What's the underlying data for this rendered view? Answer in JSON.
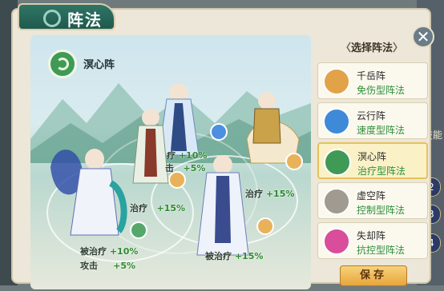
{
  "title": "阵法",
  "close_glyph": "✕",
  "side": {
    "skill_label": "技能",
    "numbers": [
      "2",
      "3",
      "4"
    ]
  },
  "scene": {
    "formation_name": "溟心阵",
    "buffs": [
      {
        "label": "疗",
        "value": "+10%"
      },
      {
        "label": "击",
        "value": "+5%"
      },
      {
        "label": "治疗",
        "value": "+15%"
      },
      {
        "label": "治疗",
        "value": "+15%"
      },
      {
        "label": "被治疗",
        "value": "+10%"
      },
      {
        "label": "攻击",
        "value": "+5%"
      },
      {
        "label": "被治疗",
        "value": "+15%"
      }
    ]
  },
  "panel": {
    "header": "选择阵法",
    "arrow_left": "〈",
    "arrow_right": "〉",
    "formations": [
      {
        "name": "千岳阵",
        "type": "免伤型阵法",
        "color": "#e2a247"
      },
      {
        "name": "云行阵",
        "type": "速度型阵法",
        "color": "#3f8ad8"
      },
      {
        "name": "溟心阵",
        "type": "治疗型阵法",
        "color": "#3f9a55",
        "selected": true
      },
      {
        "name": "虚空阵",
        "type": "控制型阵法",
        "color": "#a09a90"
      },
      {
        "name": "失却阵",
        "type": "抗控型阵法",
        "color": "#d94d9a"
      }
    ],
    "save_label": "保存"
  }
}
